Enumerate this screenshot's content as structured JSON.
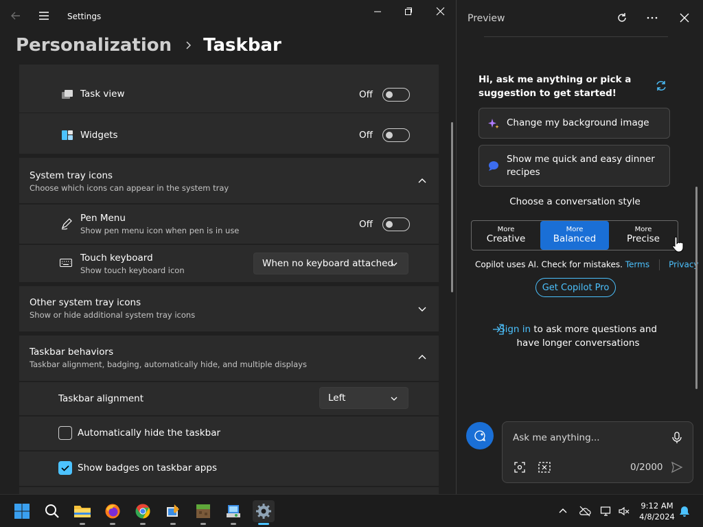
{
  "settings": {
    "title": "Settings",
    "breadcrumb": {
      "parent": "Personalization",
      "separator": ">",
      "current": "Taskbar"
    },
    "taskbar_items": [
      {
        "label": "Task view",
        "state": "Off",
        "icon": "task-view-icon"
      },
      {
        "label": "Widgets",
        "state": "Off",
        "icon": "widgets-icon"
      }
    ],
    "system_tray": {
      "title": "System tray icons",
      "description": "Choose which icons can appear in the system tray",
      "pen_menu": {
        "label": "Pen Menu",
        "description": "Show pen menu icon when pen is in use",
        "state": "Off"
      },
      "touch_keyboard": {
        "label": "Touch keyboard",
        "description": "Show touch keyboard icon",
        "value": "When no keyboard attached"
      }
    },
    "other_tray": {
      "title": "Other system tray icons",
      "description": "Show or hide additional system tray icons"
    },
    "behaviors": {
      "title": "Taskbar behaviors",
      "description": "Taskbar alignment, badging, automatically hide, and multiple displays",
      "alignment": {
        "label": "Taskbar alignment",
        "value": "Left"
      },
      "auto_hide": {
        "label": "Automatically hide the taskbar",
        "checked": false
      },
      "badges": {
        "label": "Show badges on taskbar apps",
        "checked": true
      }
    }
  },
  "preview": {
    "title": "Preview",
    "greeting": "Hi, ask me anything or pick a suggestion to get started!",
    "suggestions": [
      "Change my background image",
      "Show me quick and easy dinner recipes"
    ],
    "style_title": "Choose a conversation style",
    "styles": [
      {
        "small": "More",
        "big": "Creative",
        "active": false
      },
      {
        "small": "More",
        "big": "Balanced",
        "active": true
      },
      {
        "small": "More",
        "big": "Precise",
        "active": false
      }
    ],
    "disclaimer": "Copilot uses AI. Check for mistakes.",
    "terms": "Terms",
    "privacy": "Privacy",
    "pro_button": "Get Copilot Pro",
    "signin_link": "Sign in",
    "signin_rest": "to ask more questions and have longer conversations",
    "input_placeholder": "Ask me anything...",
    "char_count": "0/2000"
  },
  "taskbar": {
    "apps": [
      "start-icon",
      "search-icon",
      "file-explorer-icon",
      "firefox-icon",
      "chrome-icon",
      "paint-icon",
      "minecraft-icon",
      "installer-icon",
      "settings-icon"
    ],
    "time": "9:12 AM",
    "date": "4/8/2024"
  },
  "colors": {
    "accent": "#4cc2ff",
    "copilot_blue": "#1a6fd6",
    "background": "#202020",
    "card": "#2b2b2b"
  }
}
